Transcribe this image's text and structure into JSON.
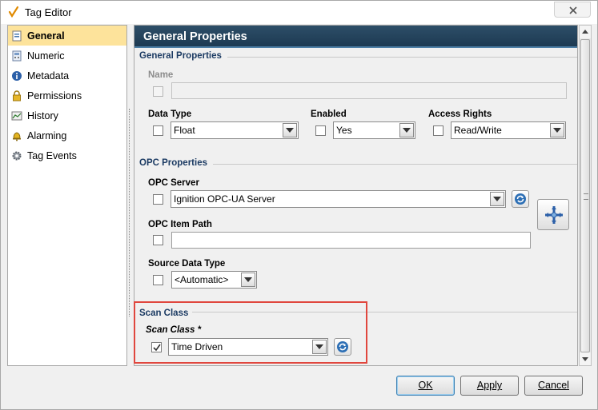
{
  "window": {
    "title": "Tag Editor"
  },
  "nav": {
    "items": [
      {
        "label": "General",
        "icon": "general-icon",
        "selected": true
      },
      {
        "label": "Numeric",
        "icon": "numeric-icon",
        "selected": false
      },
      {
        "label": "Metadata",
        "icon": "metadata-icon",
        "selected": false
      },
      {
        "label": "Permissions",
        "icon": "lock-icon",
        "selected": false
      },
      {
        "label": "History",
        "icon": "history-icon",
        "selected": false
      },
      {
        "label": "Alarming",
        "icon": "bell-icon",
        "selected": false
      },
      {
        "label": "Tag Events",
        "icon": "gear-icon",
        "selected": false
      }
    ]
  },
  "main": {
    "header": "General Properties",
    "general": {
      "title": "General Properties",
      "name_label": "Name",
      "name_value": "",
      "data_type_label": "Data Type",
      "data_type_value": "Float",
      "enabled_label": "Enabled",
      "enabled_value": "Yes",
      "access_label": "Access Rights",
      "access_value": "Read/Write"
    },
    "opc": {
      "title": "OPC Properties",
      "server_label": "OPC Server",
      "server_value": "Ignition OPC-UA Server",
      "item_path_label": "OPC Item Path",
      "item_path_value": "",
      "source_type_label": "Source Data Type",
      "source_type_value": "<Automatic>"
    },
    "scan": {
      "title": "Scan Class",
      "label": "Scan Class *",
      "value": "Time Driven",
      "checked": true
    }
  },
  "buttons": {
    "ok": "OK",
    "apply": "Apply",
    "cancel": "Cancel"
  },
  "colors": {
    "header_bg": "#1d3a52",
    "selected_bg": "#fde39b",
    "highlight": "#e0473e",
    "section_title": "#1c3b63"
  }
}
